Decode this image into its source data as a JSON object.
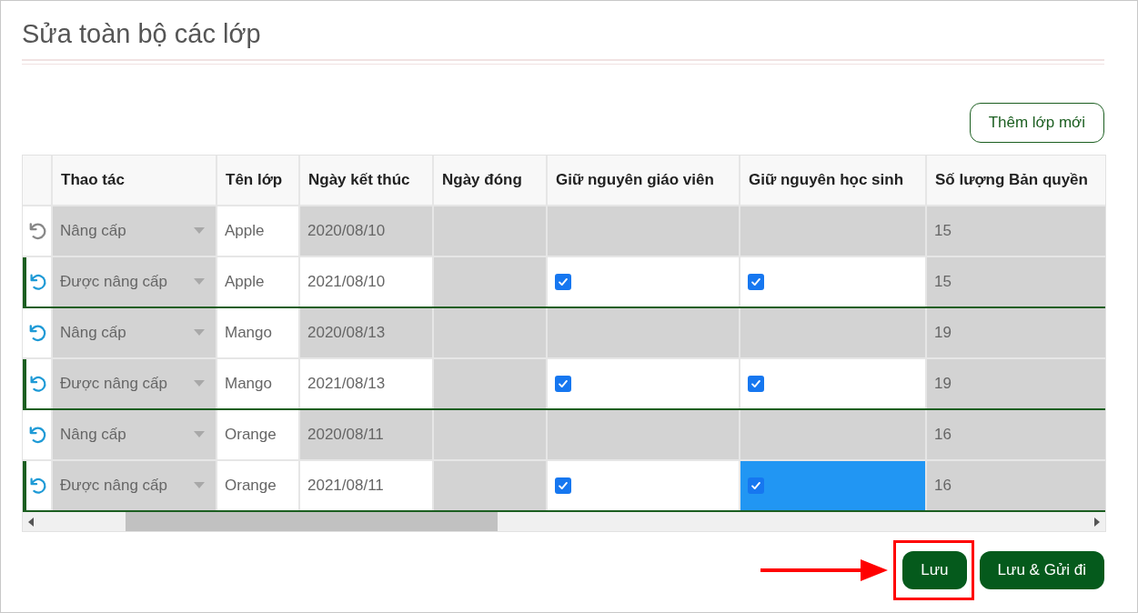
{
  "title": "Sửa toàn bộ các lớp",
  "add_button": "Thêm lớp mới",
  "table": {
    "columns": [
      "Thao tác",
      "Tên lớp",
      "Ngày kết thúc",
      "Ngày đóng",
      "Giữ nguyên giáo viên",
      "Giữ nguyên học sinh",
      "Số lượng Bản quyền"
    ],
    "rows": [
      {
        "kind": "original",
        "undo_enabled": false,
        "action": "Nâng cấp",
        "class_name": "Apple",
        "end_date": "2020/08/10",
        "licenses": "15"
      },
      {
        "kind": "upgraded",
        "undo_enabled": true,
        "action": "Được nâng cấp",
        "class_name": "Apple",
        "end_date": "2021/08/10",
        "keep_teacher": {
          "checked": true,
          "selected": false
        },
        "keep_student": {
          "checked": true,
          "selected": false
        },
        "licenses": "15"
      },
      {
        "kind": "original",
        "undo_enabled": true,
        "action": "Nâng cấp",
        "class_name": "Mango",
        "end_date": "2020/08/13",
        "licenses": "19"
      },
      {
        "kind": "upgraded",
        "undo_enabled": true,
        "action": "Được nâng cấp",
        "class_name": "Mango",
        "end_date": "2021/08/13",
        "keep_teacher": {
          "checked": true,
          "selected": false
        },
        "keep_student": {
          "checked": true,
          "selected": false
        },
        "licenses": "19"
      },
      {
        "kind": "original",
        "undo_enabled": true,
        "action": "Nâng cấp",
        "class_name": "Orange",
        "end_date": "2020/08/11",
        "licenses": "16"
      },
      {
        "kind": "upgraded",
        "undo_enabled": true,
        "action": "Được nâng cấp",
        "class_name": "Orange",
        "end_date": "2021/08/11",
        "keep_teacher": {
          "checked": true,
          "selected": false
        },
        "keep_student": {
          "checked": true,
          "selected": true
        },
        "licenses": "16"
      }
    ]
  },
  "buttons": [
    {
      "label": "Lưu",
      "highlighted": true
    },
    {
      "label": "Lưu & Gửi đi",
      "highlighted": false
    }
  ]
}
